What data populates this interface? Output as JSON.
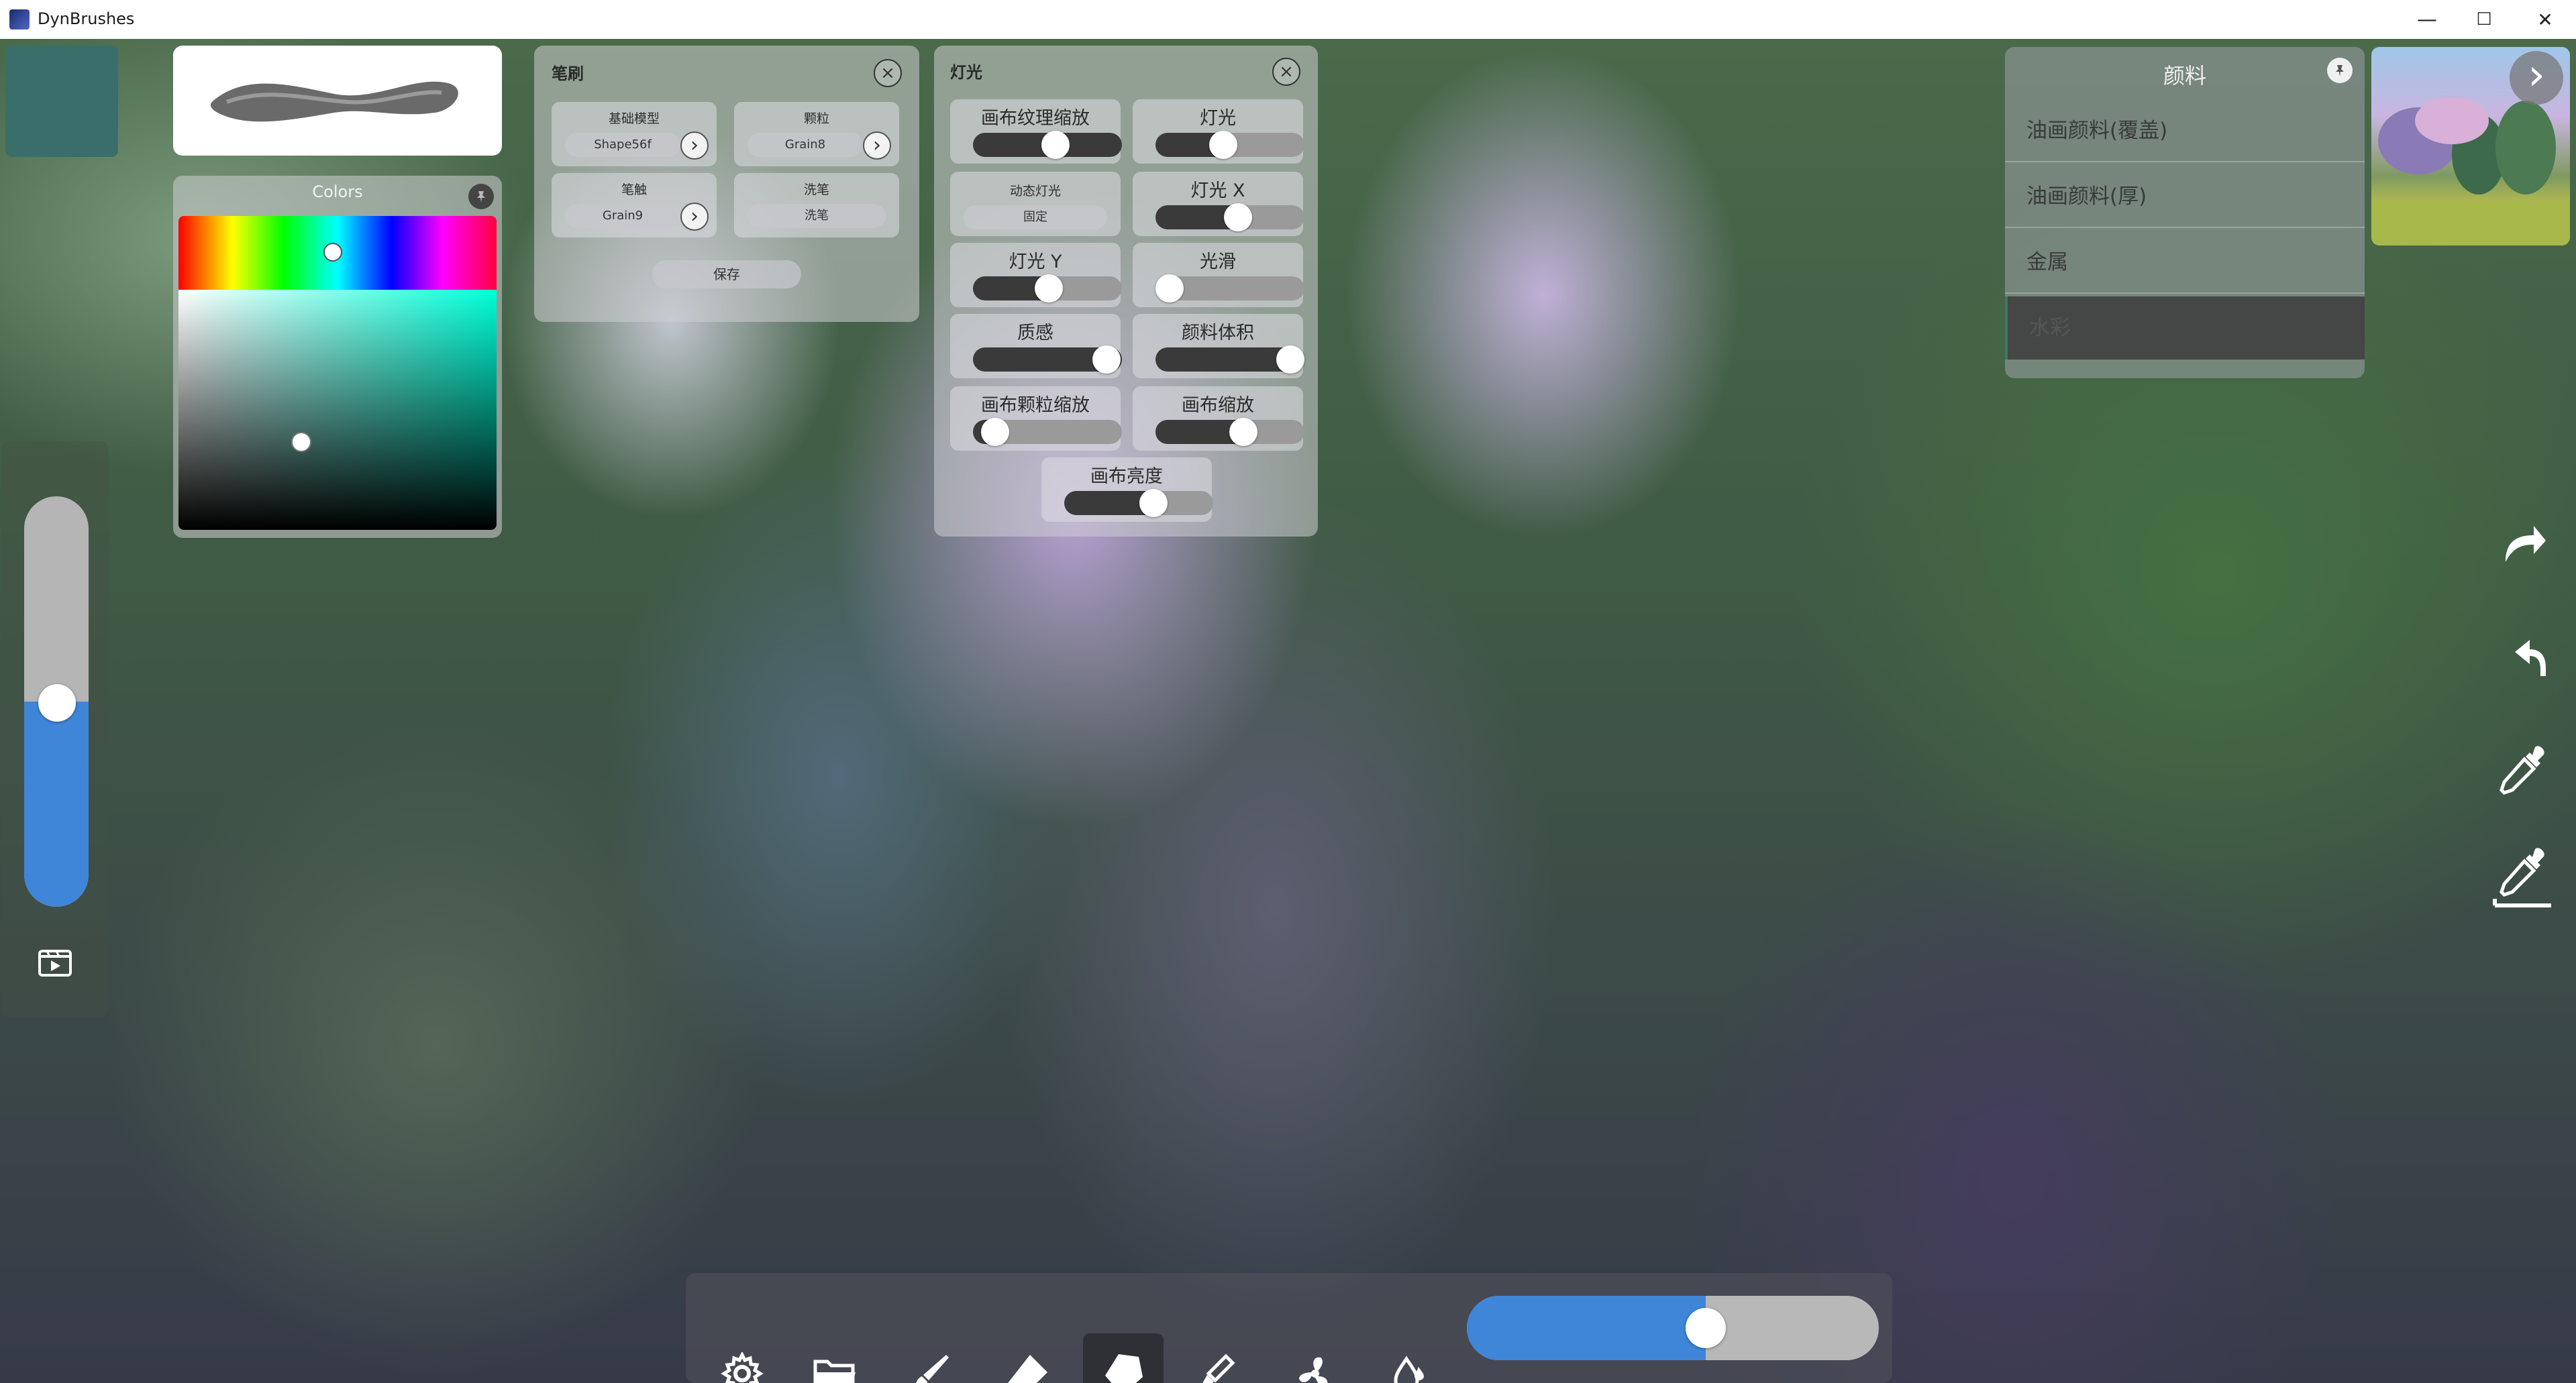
{
  "window": {
    "title": "DynBrushes",
    "controls": {
      "minimize": "—",
      "maximize": "☐",
      "close": "✕"
    }
  },
  "colors_panel": {
    "title": "Colors"
  },
  "brush_panel": {
    "title": "笔刷",
    "close": "×",
    "cells": [
      {
        "label": "基础模型",
        "value": "Shape56f",
        "has_arrow": true
      },
      {
        "label": "颗粒",
        "value": "Grain8",
        "has_arrow": true
      },
      {
        "label": "笔触",
        "value": "Grain9",
        "has_arrow": true
      },
      {
        "label": "洗笔",
        "value": "洗笔",
        "has_arrow": false
      }
    ],
    "save": "保存"
  },
  "light_panel": {
    "title": "灯光",
    "close": "×",
    "controls": [
      {
        "label": "画布纹理缩放",
        "state": "on",
        "value": 0.55
      },
      {
        "label": "灯光",
        "state": "on",
        "value": 0.45
      },
      {
        "label": "动态灯光",
        "value_text": "固定"
      },
      {
        "label": "灯光 X",
        "state": "on",
        "value": 0.55
      },
      {
        "label": "灯光 Y",
        "state": "on",
        "value": 0.5
      },
      {
        "label": "光滑",
        "state": "off",
        "value": 0.0
      },
      {
        "label": "质感",
        "state": "on",
        "value": 0.9
      },
      {
        "label": "颜料体积",
        "state": "on",
        "value": 0.95
      },
      {
        "label": "画布颗粒缩放",
        "state": "on",
        "value": 0.1
      },
      {
        "label": "画布缩放",
        "state": "on",
        "value": 0.6
      },
      {
        "label": "画布亮度",
        "state": "on",
        "value": 0.6
      }
    ]
  },
  "paints_panel": {
    "title": "颜料",
    "items": [
      "油画颜料(覆盖)",
      "油画颜料(厚)",
      "金属",
      "水彩"
    ],
    "selected_index": 3
  },
  "right_tools": {
    "next": "›",
    "redo": "redo-icon",
    "undo": "undo-icon",
    "eyedropper": "eyedropper-icon",
    "eyedropper_edit": "eyedropper-edit-icon"
  },
  "bottom_toolbar": {
    "tools": [
      "gear-icon",
      "folder-icon",
      "brush-icon",
      "eraser-icon",
      "smudge-icon",
      "wet-brush-icon",
      "fan-icon",
      "water-drop-icon"
    ],
    "active_tool": "smudge-icon",
    "size_slider": 0.58
  },
  "left_slider": {
    "value": 0.5
  },
  "accent": "#3f86d8",
  "current_color": "#3a6e6a"
}
